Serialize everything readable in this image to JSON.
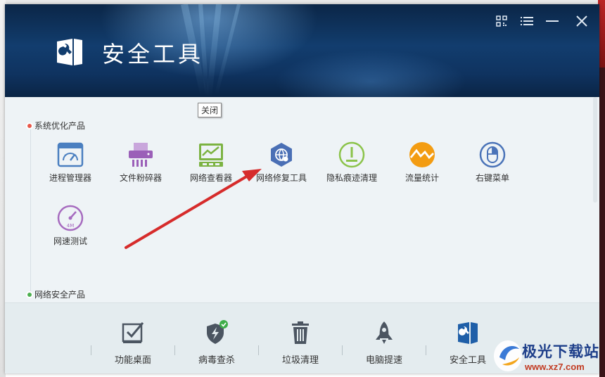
{
  "app": {
    "title": "安全工具"
  },
  "window_controls": {
    "icons": [
      "qrcode-icon",
      "menu-icon",
      "minimize-icon",
      "close-icon"
    ]
  },
  "tooltip": {
    "text": "关闭"
  },
  "sections": [
    {
      "title": "系统优化产品",
      "dot_color": "#e8574a",
      "tools": [
        {
          "label": "进程管理器",
          "icon": "process-manager-icon",
          "color": "#4a7fc0"
        },
        {
          "label": "文件粉碎器",
          "icon": "file-shredder-icon",
          "color": "#9b5fb8"
        },
        {
          "label": "网络查看器",
          "icon": "network-monitor-icon",
          "color": "#7cb342"
        },
        {
          "label": "网络修复工具",
          "icon": "network-repair-icon",
          "color": "#4a6fb5"
        },
        {
          "label": "隐私痕迹清理",
          "icon": "privacy-cleaner-icon",
          "color": "#8bc34a"
        },
        {
          "label": "流量统计",
          "icon": "traffic-stats-icon",
          "color": "#f39c12"
        },
        {
          "label": "右键菜单",
          "icon": "right-click-menu-icon",
          "color": "#4a73b8"
        },
        {
          "label": "网速测试",
          "icon": "speed-test-icon",
          "color": "#a66bbf"
        }
      ]
    },
    {
      "title": "网络安全产品",
      "dot_color": "#4caf50",
      "tools": []
    }
  ],
  "bottom_nav": [
    {
      "label": "功能桌面",
      "icon": "desktop-check-icon"
    },
    {
      "label": "病毒查杀",
      "icon": "virus-scan-icon"
    },
    {
      "label": "垃圾清理",
      "icon": "trash-icon"
    },
    {
      "label": "电脑提速",
      "icon": "rocket-icon"
    },
    {
      "label": "安全工具",
      "icon": "security-tools-icon"
    }
  ],
  "watermark": {
    "text": "极光下载站",
    "url": "www.xz7.com"
  },
  "colors": {
    "header": "#123d6e",
    "content_bg": "#eef3f6",
    "bottom_bg": "#e4ecef",
    "annotation_arrow": "#d62b2b"
  }
}
